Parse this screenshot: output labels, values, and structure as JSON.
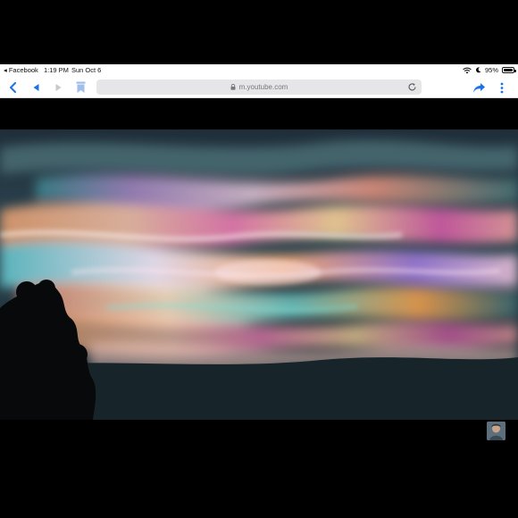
{
  "status_bar": {
    "back_app": "◂ Facebook",
    "time": "1:19 PM",
    "date": "Sun Oct 6",
    "battery": "95%",
    "battery_level": 0.95
  },
  "toolbar": {
    "url": "m.youtube.com",
    "icons": [
      "chevron-left-icon",
      "back-triangle-icon",
      "forward-triangle-icon",
      "bookmark-icon",
      "lock-icon",
      "reload-icon",
      "share-icon",
      "more-icon"
    ]
  },
  "colors": {
    "accent": "#1a73e8",
    "disabled": "#c7c7cc",
    "url_bar": "#e6e6e9"
  }
}
